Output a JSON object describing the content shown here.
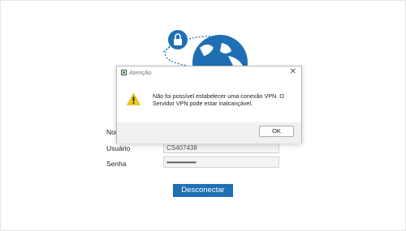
{
  "form": {
    "name_label": "Nome",
    "user_label": "Usuário",
    "user_value": "CS407438",
    "password_label": "Senha",
    "password_value": "••••••••••••••••••••",
    "disconnect_label": "Desconectar"
  },
  "dialog": {
    "title": "Atenção",
    "close_glyph": "✕",
    "message": "Não foi possível estabelecer uma conexão VPN. O Servidor VPN pode estar inalcançável.",
    "ok_label": "OK"
  },
  "colors": {
    "accent": "#1f6fb5",
    "warning": "#f2c811"
  },
  "icons": [
    "lock-icon",
    "globe-icon",
    "app-icon",
    "close-icon",
    "warning-icon"
  ]
}
